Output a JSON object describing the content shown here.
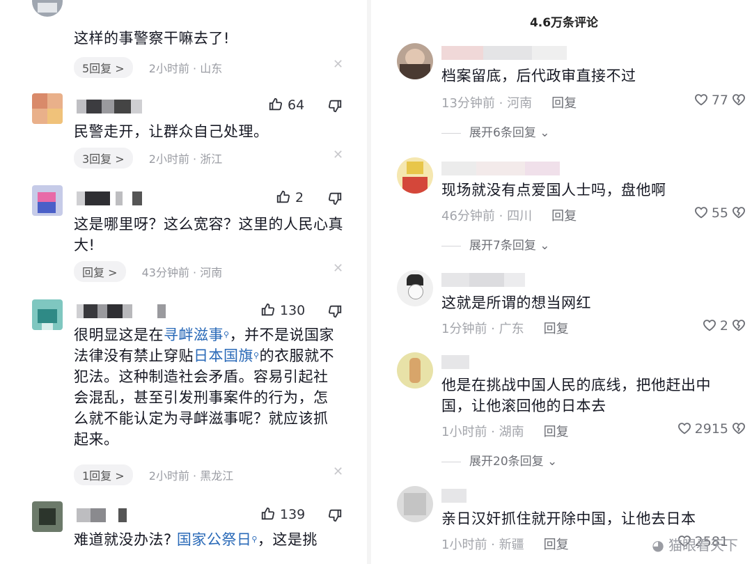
{
  "left": {
    "comments": [
      {
        "text": "这样的事警察干嘛去了!",
        "replies": "5回复 >",
        "time": "2小时前 · 山东"
      },
      {
        "text": "民警走开，让群众自己处理。",
        "likes": "64",
        "replies": "3回复 >",
        "time": "2小时前 · 浙江"
      },
      {
        "text": "这是哪里呀？这么宽容？这里的人民心真大!",
        "likes": "2",
        "replies": "回复 >",
        "time": "43分钟前 · 河南"
      },
      {
        "text_parts": [
          "很明显这是在",
          "寻衅滋事",
          "，并不是说国家法律没有禁止穿贴",
          "日本国旗",
          "的衣服就不犯法。这种制造社会矛盾。容易引起社会混乱，甚至引发刑事案件的行为，怎么就不能认定为寻衅滋事呢？就应该抓起来。"
        ],
        "likes": "130",
        "replies": "1回复 >",
        "time": "2小时前 · 黑龙江"
      },
      {
        "text_parts": [
          "难道就没办法?",
          "国家公祭日",
          "，这是挑"
        ],
        "likes": "139"
      }
    ]
  },
  "right": {
    "header": "4.6万条评论",
    "comments": [
      {
        "text": "档案留底，后代政审直接不过",
        "time": "13分钟前 · 河南",
        "reply": "回复",
        "likes": "77",
        "expand": "展开6条回复"
      },
      {
        "text": "现场就没有点爱国人士吗，盘他啊",
        "time": "46分钟前 · 四川",
        "reply": "回复",
        "likes": "55",
        "expand": "展开7条回复"
      },
      {
        "text": "这就是所谓的想当网红",
        "time": "1分钟前 · 广东",
        "reply": "回复",
        "likes": "2"
      },
      {
        "text": "他是在挑战中国人民的底线，把他赶出中国，让他滚回他的日本去",
        "time": "1小时前 · 湖南",
        "reply": "回复",
        "likes": "2915",
        "expand": "展开20条回复"
      },
      {
        "text": "亲日汉奸抓住就开除中国，让他去日本",
        "time": "1小时前 · 新疆",
        "reply": "回复",
        "likes": "2581"
      }
    ],
    "watermark": "猫眼看天下"
  },
  "icons": {
    "like": "thumb-up-icon",
    "dislike": "thumb-down-icon",
    "heart": "heart-icon",
    "broken_heart": "broken-heart-icon",
    "close": "close-icon",
    "chevron": "chevron-down-icon",
    "wechat": "wechat-icon"
  },
  "colors": {
    "link": "#2a6ab8",
    "meta": "#9a9ca3",
    "text": "#161823"
  }
}
